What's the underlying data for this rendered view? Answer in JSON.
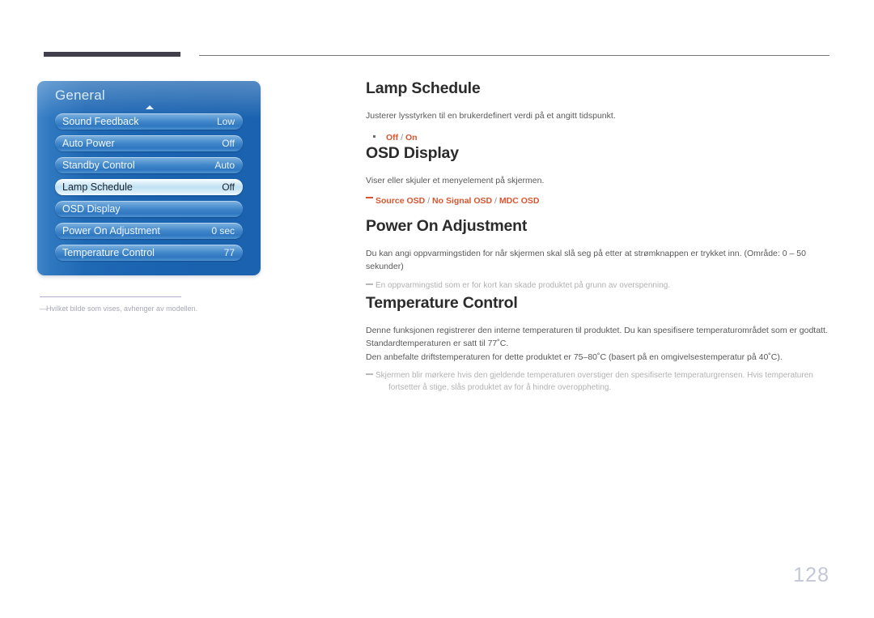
{
  "page": {
    "number": "128"
  },
  "figure": {
    "osd": {
      "title": "General",
      "scroll_up_icon": "triangle-up-icon",
      "items": [
        {
          "label": "Sound Feedback",
          "value": "Low",
          "selected": false
        },
        {
          "label": "Auto Power",
          "value": "Off",
          "selected": false
        },
        {
          "label": "Standby Control",
          "value": "Auto",
          "selected": false
        },
        {
          "label": "Lamp Schedule",
          "value": "Off",
          "selected": true
        },
        {
          "label": "OSD Display",
          "value": "",
          "selected": false
        },
        {
          "label": "Power On Adjustment",
          "value": "0 sec",
          "selected": false
        },
        {
          "label": "Temperature Control",
          "value": "77",
          "selected": false
        }
      ]
    },
    "note_dash": "―",
    "note": "Hvilket bilde som vises, avhenger av modellen."
  },
  "sections": {
    "lamp_schedule": {
      "title": "Lamp Schedule",
      "description": "Justerer lysstyrken til en brukerdefinert verdi på et angitt tidspunkt.",
      "options": {
        "opt1": "Off",
        "sep1": " / ",
        "opt2": "On"
      }
    },
    "osd_display": {
      "title": "OSD Display",
      "description": "Viser eller skjuler et menyelement på skjermen.",
      "options": {
        "opt1": "Source OSD",
        "sep1": " / ",
        "opt2": "No Signal OSD",
        "sep2": " / ",
        "opt3": "MDC OSD"
      }
    },
    "power_on_adjustment": {
      "title": "Power On Adjustment",
      "description": "Du kan angi oppvarmingstiden for når skjermen skal slå seg på etter at strømknappen er trykket inn. (Område: 0 – 50 sekunder)",
      "note": "En oppvarmingstid som er for kort kan skade produktet på grunn av overspenning."
    },
    "temperature_control": {
      "title": "Temperature Control",
      "description_1": "Denne funksjonen registrerer den interne temperaturen til produktet. Du kan spesifisere temperaturområdet som er godtatt.",
      "description_2": "Standardtemperaturen er satt til 77˚C.",
      "description_3": "Den anbefalte driftstemperaturen for dette produktet er 75–80˚C (basert på en omgivelsestemperatur på 40˚C).",
      "note_line_1": "Skjermen blir mørkere hvis den gjeldende temperaturen overstiger den spesifiserte temperaturgrensen. Hvis temperaturen",
      "note_line_2": "fortsetter å stige, slås produktet av for å hindre overoppheting."
    }
  },
  "colors": {
    "accent_orange": "#d9552f",
    "header_rule_dark": "#413f4c",
    "panel_blue": "#1a63b0"
  }
}
